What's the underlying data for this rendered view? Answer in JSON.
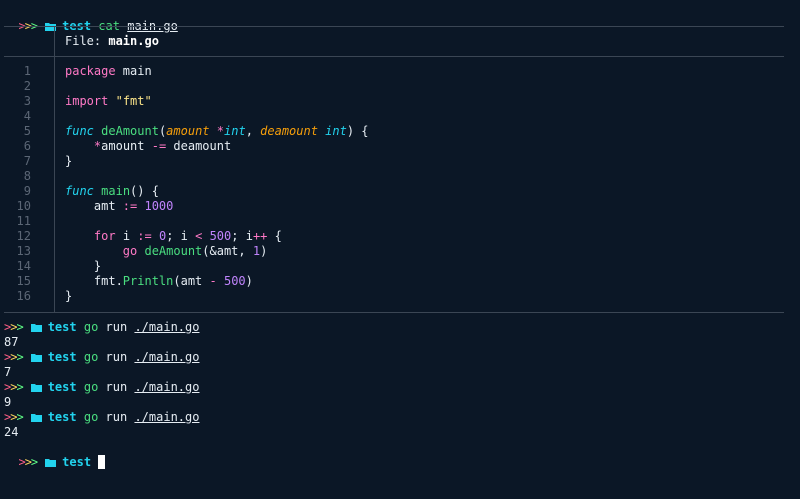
{
  "prompt": {
    "arrows": ">>>",
    "dir": "test",
    "folder_icon": "folder-icon"
  },
  "first_command": {
    "cmd": "cat",
    "path": "main.go"
  },
  "file_header": {
    "label": "File:",
    "name": "main.go"
  },
  "code_lines": [
    {
      "n": "1",
      "tokens": [
        {
          "t": "package",
          "c": "kw"
        },
        {
          "t": " main",
          "c": "plain"
        }
      ]
    },
    {
      "n": "2",
      "tokens": []
    },
    {
      "n": "3",
      "tokens": [
        {
          "t": "import",
          "c": "kw"
        },
        {
          "t": " ",
          "c": "plain"
        },
        {
          "t": "\"fmt\"",
          "c": "str"
        }
      ]
    },
    {
      "n": "4",
      "tokens": []
    },
    {
      "n": "5",
      "tokens": [
        {
          "t": "func",
          "c": "fnkw"
        },
        {
          "t": " ",
          "c": "plain"
        },
        {
          "t": "deAmount",
          "c": "fn"
        },
        {
          "t": "(",
          "c": "plain"
        },
        {
          "t": "amount",
          "c": "param"
        },
        {
          "t": " ",
          "c": "plain"
        },
        {
          "t": "*",
          "c": "op"
        },
        {
          "t": "int",
          "c": "typ"
        },
        {
          "t": ", ",
          "c": "plain"
        },
        {
          "t": "deamount",
          "c": "param"
        },
        {
          "t": " ",
          "c": "plain"
        },
        {
          "t": "int",
          "c": "typ"
        },
        {
          "t": ") {",
          "c": "plain"
        }
      ]
    },
    {
      "n": "6",
      "tokens": [
        {
          "t": "    ",
          "c": "plain"
        },
        {
          "t": "*",
          "c": "op"
        },
        {
          "t": "amount ",
          "c": "plain"
        },
        {
          "t": "-=",
          "c": "op"
        },
        {
          "t": " deamount",
          "c": "plain"
        }
      ]
    },
    {
      "n": "7",
      "tokens": [
        {
          "t": "}",
          "c": "plain"
        }
      ]
    },
    {
      "n": "8",
      "tokens": []
    },
    {
      "n": "9",
      "tokens": [
        {
          "t": "func",
          "c": "fnkw"
        },
        {
          "t": " ",
          "c": "plain"
        },
        {
          "t": "main",
          "c": "fn"
        },
        {
          "t": "() {",
          "c": "plain"
        }
      ]
    },
    {
      "n": "10",
      "tokens": [
        {
          "t": "    amt ",
          "c": "plain"
        },
        {
          "t": ":=",
          "c": "op"
        },
        {
          "t": " ",
          "c": "plain"
        },
        {
          "t": "1000",
          "c": "num"
        }
      ]
    },
    {
      "n": "11",
      "tokens": []
    },
    {
      "n": "12",
      "tokens": [
        {
          "t": "    ",
          "c": "plain"
        },
        {
          "t": "for",
          "c": "kw"
        },
        {
          "t": " i ",
          "c": "plain"
        },
        {
          "t": ":=",
          "c": "op"
        },
        {
          "t": " ",
          "c": "plain"
        },
        {
          "t": "0",
          "c": "num"
        },
        {
          "t": "; i ",
          "c": "plain"
        },
        {
          "t": "<",
          "c": "op"
        },
        {
          "t": " ",
          "c": "plain"
        },
        {
          "t": "500",
          "c": "num"
        },
        {
          "t": "; i",
          "c": "plain"
        },
        {
          "t": "++",
          "c": "op"
        },
        {
          "t": " {",
          "c": "plain"
        }
      ]
    },
    {
      "n": "13",
      "tokens": [
        {
          "t": "        ",
          "c": "plain"
        },
        {
          "t": "go",
          "c": "kw"
        },
        {
          "t": " ",
          "c": "plain"
        },
        {
          "t": "deAmount",
          "c": "fn"
        },
        {
          "t": "(&amt, ",
          "c": "plain"
        },
        {
          "t": "1",
          "c": "num"
        },
        {
          "t": ")",
          "c": "plain"
        }
      ]
    },
    {
      "n": "14",
      "tokens": [
        {
          "t": "    }",
          "c": "plain"
        }
      ]
    },
    {
      "n": "15",
      "tokens": [
        {
          "t": "    fmt.",
          "c": "plain"
        },
        {
          "t": "Println",
          "c": "fn"
        },
        {
          "t": "(amt ",
          "c": "plain"
        },
        {
          "t": "-",
          "c": "op"
        },
        {
          "t": " ",
          "c": "plain"
        },
        {
          "t": "500",
          "c": "num"
        },
        {
          "t": ")",
          "c": "plain"
        }
      ]
    },
    {
      "n": "16",
      "tokens": [
        {
          "t": "}",
          "c": "plain"
        }
      ]
    }
  ],
  "runs": [
    {
      "cmd": "go",
      "arg": "run",
      "path": "./main.go",
      "output": "87"
    },
    {
      "cmd": "go",
      "arg": "run",
      "path": "./main.go",
      "output": "7"
    },
    {
      "cmd": "go",
      "arg": "run",
      "path": "./main.go",
      "output": "9"
    },
    {
      "cmd": "go",
      "arg": "run",
      "path": "./main.go",
      "output": "24"
    }
  ]
}
